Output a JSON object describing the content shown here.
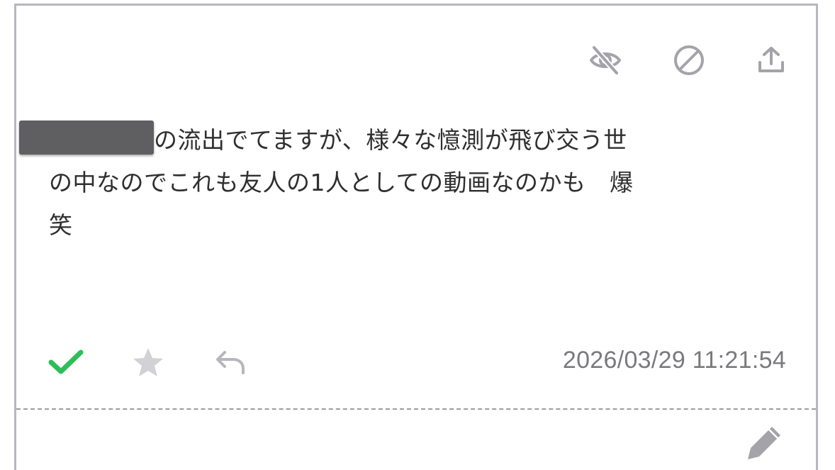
{
  "icons": {
    "hide": "eye-off-icon",
    "block": "block-icon",
    "share": "share-upload-icon",
    "check": "checkmark-icon",
    "star": "star-icon",
    "reply": "reply-icon",
    "edit": "pencil-icon"
  },
  "message": {
    "text_line1": "の流出でてますが、様々な憶測が飛び交う世",
    "text_line2": "の中なのでこれも友人の1人としての動画なのかも　爆",
    "text_line3": "笑"
  },
  "timestamp": "2026/03/29 11:21:54",
  "colors": {
    "check": "#2dbe5a",
    "icon_gray": "#a4a3aa",
    "star_gray": "#d2d1d6",
    "border": "#b8b7bf",
    "redaction": "#5f5f62"
  }
}
